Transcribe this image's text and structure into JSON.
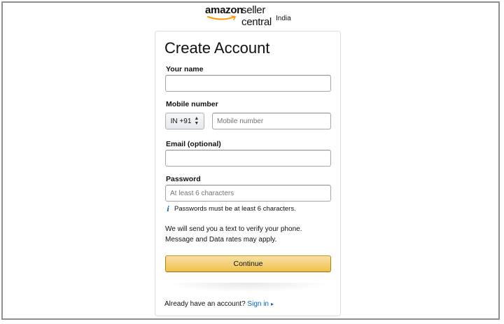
{
  "logo": {
    "brand": "amazon",
    "product": "seller central",
    "region": "India"
  },
  "form": {
    "title": "Create Account",
    "name": {
      "label": "Your name",
      "value": "",
      "placeholder": ""
    },
    "mobile": {
      "label": "Mobile number",
      "country_code": "IN +91",
      "value": "",
      "placeholder": "Mobile number"
    },
    "email": {
      "label": "Email (optional)",
      "value": "",
      "placeholder": ""
    },
    "password": {
      "label": "Password",
      "value": "",
      "placeholder": "At least 6 characters",
      "hint": "Passwords must be at least 6 characters."
    },
    "verify_note": {
      "line1": "We will send you a text to verify your phone.",
      "line2": "Message and Data rates may apply."
    },
    "continue_label": "Continue",
    "signin_prompt": "Already have an account?",
    "signin_link": "Sign in"
  },
  "colors": {
    "accent_button": "#f0c14b",
    "link": "#0066c0",
    "frame_border": "#8f8f8f"
  },
  "icons": {
    "hint": "info-icon",
    "country_select": "updown-arrows-icon",
    "signin_caret": "caret-right-icon"
  }
}
